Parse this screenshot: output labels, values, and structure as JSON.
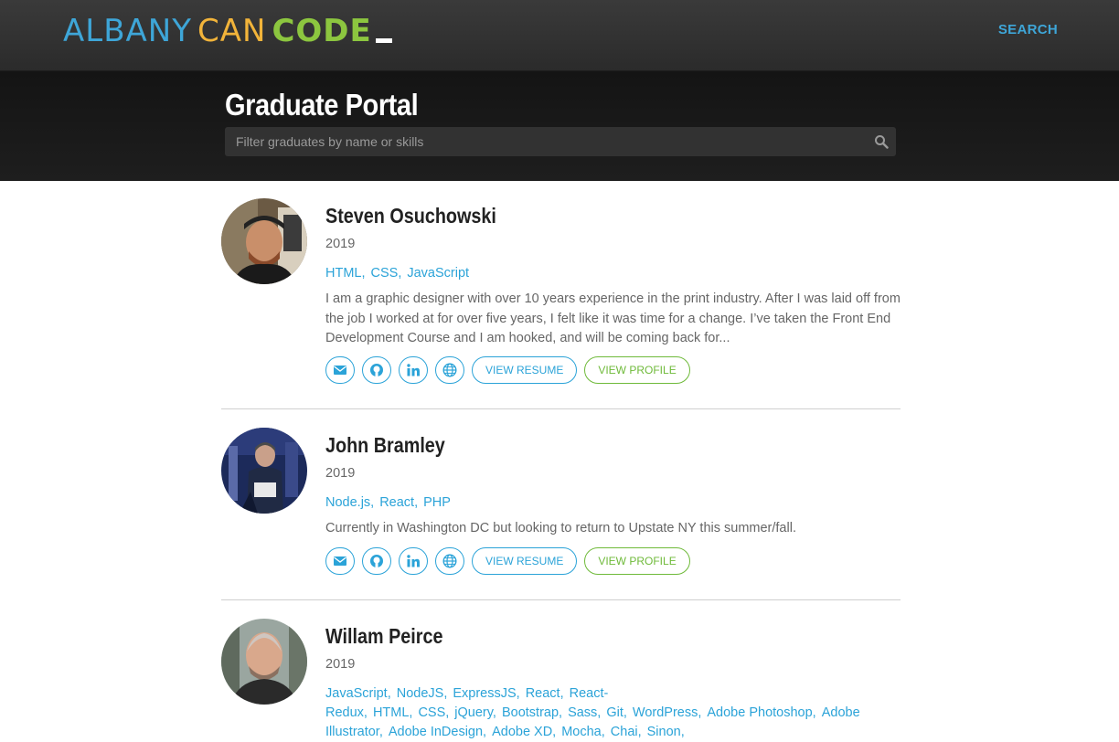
{
  "header": {
    "logo": {
      "part1": "ALBANY",
      "part2": "CAN",
      "part3": "CODE"
    },
    "nav_search": "SEARCH"
  },
  "hero": {
    "title": "Graduate Portal",
    "filter_placeholder": "Filter graduates by name or skills"
  },
  "graduates": [
    {
      "name": "Steven Osuchowski",
      "year": "2019",
      "skills": [
        "HTML,",
        "CSS,",
        "JavaScript"
      ],
      "bio": "I am a graphic designer with over 10 years experience in the print industry. After I was laid off from the job I worked at for over five years, I felt like it was time for a change. I’ve taken the Front End Development Course and I am hooked, and will be coming back for...",
      "view_resume": "VIEW RESUME",
      "view_profile": "VIEW PROFILE"
    },
    {
      "name": "John Bramley",
      "year": "2019",
      "skills": [
        "Node.js,",
        "React,",
        "PHP"
      ],
      "bio": "Currently in Washington DC but looking to return to Upstate NY this summer/fall.",
      "view_resume": "VIEW RESUME",
      "view_profile": "VIEW PROFILE"
    },
    {
      "name": "Willam Peirce",
      "year": "2019",
      "skills": [
        "JavaScript,",
        "NodeJS,",
        "ExpressJS,",
        "React,",
        "React-Redux,",
        "HTML,",
        "CSS,",
        "jQuery,",
        "Bootstrap,",
        "Sass,",
        "Git,",
        "WordPress,",
        "Adobe Photoshop,",
        "Adobe Illustrator,",
        "Adobe InDesign,",
        "Adobe XD,",
        "Mocha,",
        "Chai,",
        "Sinon,"
      ]
    }
  ],
  "icons": [
    "envelope-icon",
    "github-icon",
    "linkedin-icon",
    "globe-icon",
    "search-icon"
  ],
  "colors": {
    "accent_blue": "#2ba3d8",
    "accent_green": "#6fba3a",
    "logo_blue": "#3ea6d8",
    "logo_yellow": "#f2b43a",
    "logo_green": "#8cc63f"
  }
}
